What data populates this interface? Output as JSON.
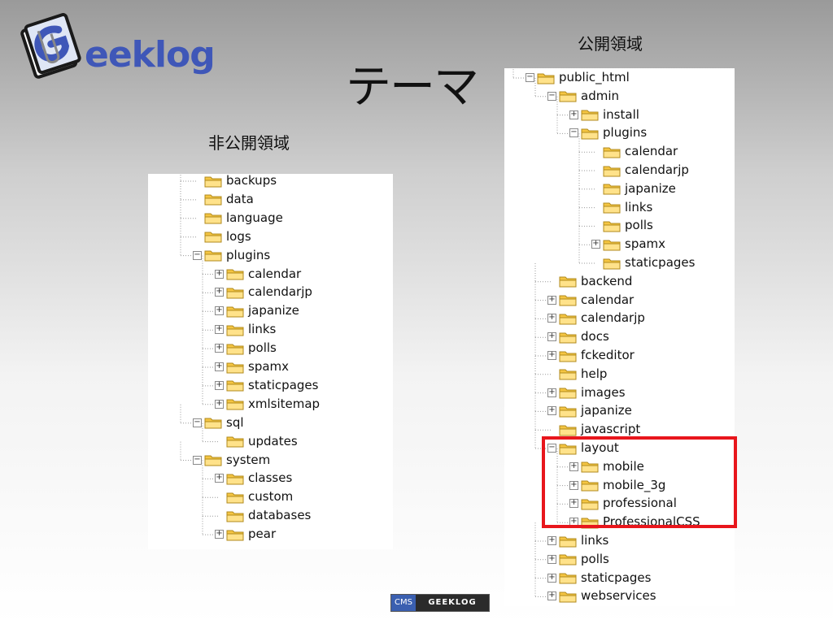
{
  "logo": {
    "text": "eeklog",
    "icon": "geeklog-paperclip-logo-icon"
  },
  "title": "テーマ",
  "captions": {
    "private": "非公開領域",
    "public": "公開領域"
  },
  "left_tree": [
    {
      "label": "backups",
      "expander": "none",
      "depth": 1
    },
    {
      "label": "data",
      "expander": "none",
      "depth": 1
    },
    {
      "label": "language",
      "expander": "none",
      "depth": 1
    },
    {
      "label": "logs",
      "expander": "none",
      "depth": 1
    },
    {
      "label": "plugins",
      "expander": "minus",
      "depth": 1
    },
    {
      "label": "calendar",
      "expander": "plus",
      "depth": 2
    },
    {
      "label": "calendarjp",
      "expander": "plus",
      "depth": 2
    },
    {
      "label": "japanize",
      "expander": "plus",
      "depth": 2
    },
    {
      "label": "links",
      "expander": "plus",
      "depth": 2
    },
    {
      "label": "polls",
      "expander": "plus",
      "depth": 2
    },
    {
      "label": "spamx",
      "expander": "plus",
      "depth": 2
    },
    {
      "label": "staticpages",
      "expander": "plus",
      "depth": 2
    },
    {
      "label": "xmlsitemap",
      "expander": "plus",
      "depth": 2
    },
    {
      "label": "sql",
      "expander": "minus",
      "depth": 1
    },
    {
      "label": "updates",
      "expander": "none",
      "depth": 2
    },
    {
      "label": "system",
      "expander": "minus",
      "depth": 1
    },
    {
      "label": "classes",
      "expander": "plus",
      "depth": 2
    },
    {
      "label": "custom",
      "expander": "none",
      "depth": 2
    },
    {
      "label": "databases",
      "expander": "none",
      "depth": 2
    },
    {
      "label": "pear",
      "expander": "plus",
      "depth": 2
    }
  ],
  "right_tree": [
    {
      "label": "public_html",
      "expander": "minus",
      "depth": 0
    },
    {
      "label": "admin",
      "expander": "minus",
      "depth": 1
    },
    {
      "label": "install",
      "expander": "plus",
      "depth": 2
    },
    {
      "label": "plugins",
      "expander": "minus",
      "depth": 2
    },
    {
      "label": "calendar",
      "expander": "none",
      "depth": 3
    },
    {
      "label": "calendarjp",
      "expander": "none",
      "depth": 3
    },
    {
      "label": "japanize",
      "expander": "none",
      "depth": 3
    },
    {
      "label": "links",
      "expander": "none",
      "depth": 3
    },
    {
      "label": "polls",
      "expander": "none",
      "depth": 3
    },
    {
      "label": "spamx",
      "expander": "plus",
      "depth": 3
    },
    {
      "label": "staticpages",
      "expander": "none",
      "depth": 3
    },
    {
      "label": "backend",
      "expander": "none",
      "depth": 1
    },
    {
      "label": "calendar",
      "expander": "plus",
      "depth": 1
    },
    {
      "label": "calendarjp",
      "expander": "plus",
      "depth": 1
    },
    {
      "label": "docs",
      "expander": "plus",
      "depth": 1
    },
    {
      "label": "fckeditor",
      "expander": "plus",
      "depth": 1
    },
    {
      "label": "help",
      "expander": "none",
      "depth": 1
    },
    {
      "label": "images",
      "expander": "plus",
      "depth": 1
    },
    {
      "label": "japanize",
      "expander": "plus",
      "depth": 1
    },
    {
      "label": "javascript",
      "expander": "none",
      "depth": 1
    },
    {
      "label": "layout",
      "expander": "minus",
      "depth": 1
    },
    {
      "label": "mobile",
      "expander": "plus",
      "depth": 2
    },
    {
      "label": "mobile_3g",
      "expander": "plus",
      "depth": 2
    },
    {
      "label": "professional",
      "expander": "plus",
      "depth": 2
    },
    {
      "label": "ProfessionalCSS",
      "expander": "plus",
      "depth": 2
    },
    {
      "label": "links",
      "expander": "plus",
      "depth": 1
    },
    {
      "label": "polls",
      "expander": "plus",
      "depth": 1
    },
    {
      "label": "staticpages",
      "expander": "plus",
      "depth": 1
    },
    {
      "label": "webservices",
      "expander": "plus",
      "depth": 1
    }
  ],
  "highlight_color": "#e8161c",
  "folder_color": "#f5c542",
  "badge": {
    "cms": "CMS",
    "name": "GEEKLOG"
  }
}
